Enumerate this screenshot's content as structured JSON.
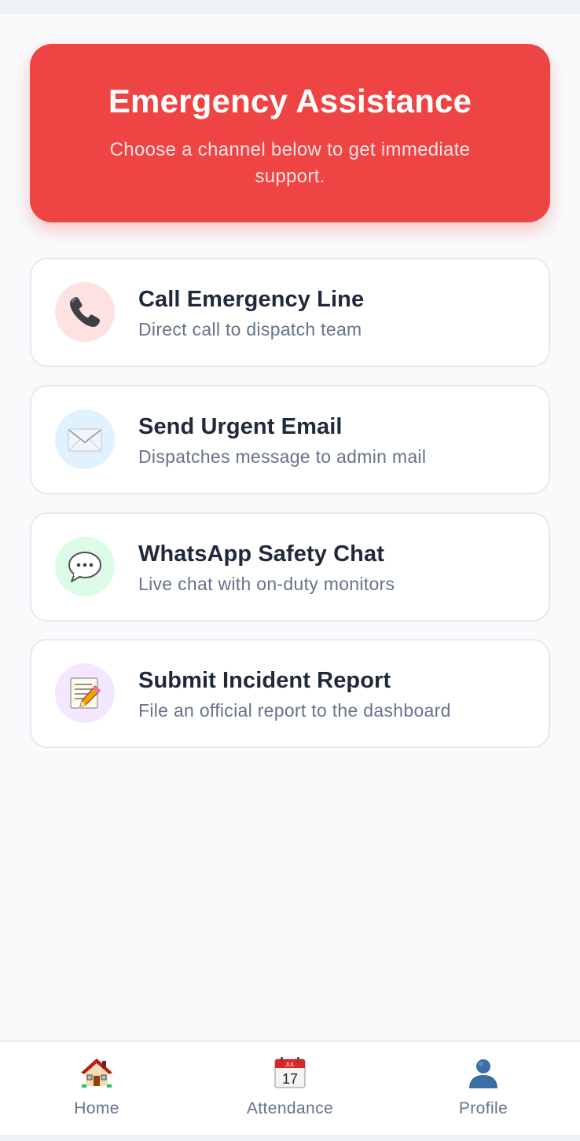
{
  "hero": {
    "title": "Emergency Assistance",
    "subtitle": "Choose a channel below to get immediate support.",
    "color": "#ef4444"
  },
  "options": [
    {
      "title": "Call Emergency Line",
      "subtitle": "Direct call to dispatch team",
      "icon": "telephone-receiver-icon",
      "icon_bg": "#fee2e2"
    },
    {
      "title": "Send Urgent Email",
      "subtitle": "Dispatches message to admin mail",
      "icon": "envelope-icon",
      "icon_bg": "#e0f2fe"
    },
    {
      "title": "WhatsApp Safety Chat",
      "subtitle": "Live chat with on-duty monitors",
      "icon": "speech-bubble-icon",
      "icon_bg": "#dcfce7"
    },
    {
      "title": "Submit Incident Report",
      "subtitle": "File an official report to the dashboard",
      "icon": "memo-pencil-icon",
      "icon_bg": "#f3e8ff"
    }
  ],
  "nav": {
    "items": [
      {
        "label": "Home",
        "icon": "house-icon"
      },
      {
        "label": "Attendance",
        "icon": "calendar-icon",
        "calendar_month": "JUL",
        "calendar_day": "17"
      },
      {
        "label": "Profile",
        "icon": "person-silhouette-icon"
      }
    ]
  }
}
